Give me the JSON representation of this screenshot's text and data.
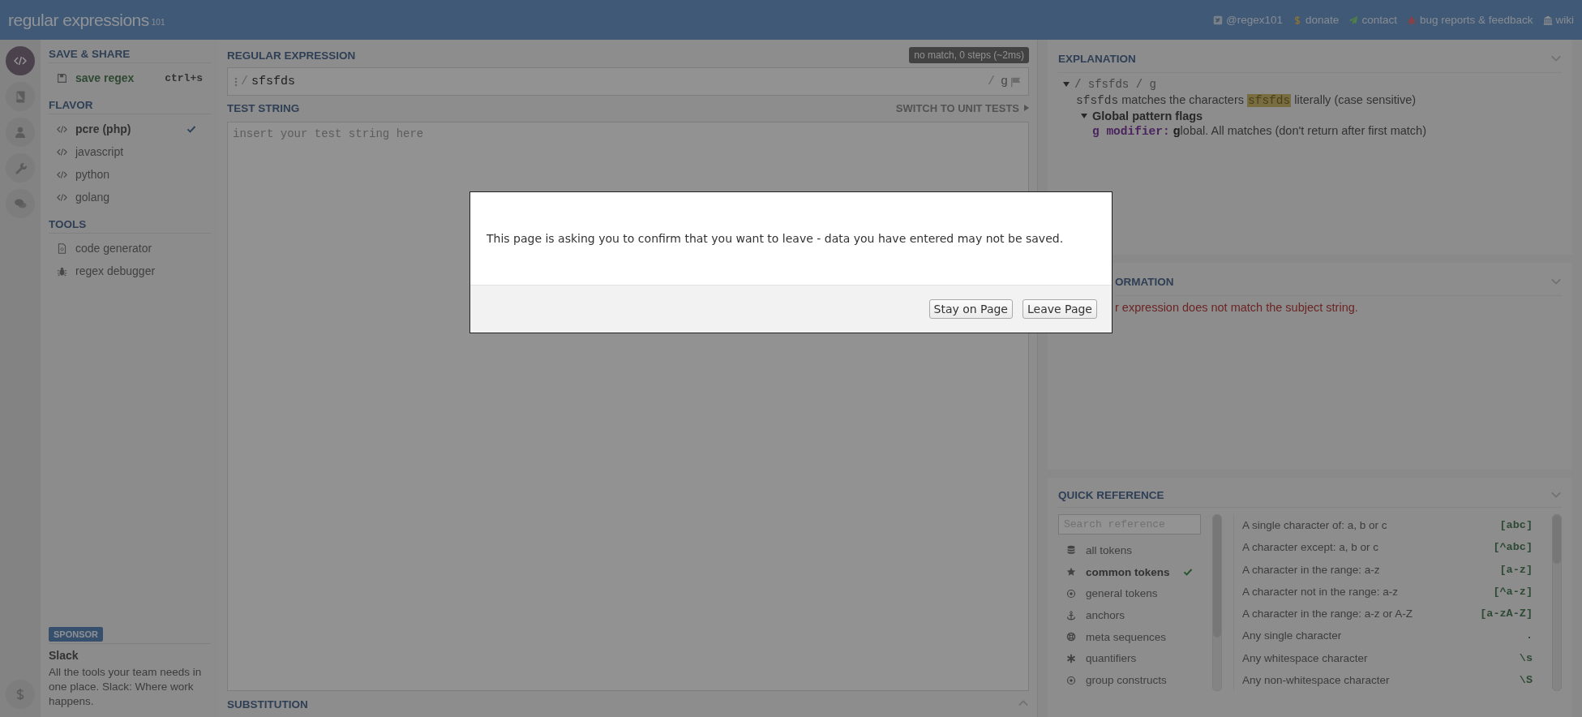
{
  "topbar": {
    "logo": "regular expressions",
    "logo_badge": "101",
    "links": [
      {
        "label": "@regex101",
        "kind": "bird"
      },
      {
        "label": "donate",
        "kind": "dollar"
      },
      {
        "label": "contact",
        "kind": "plane"
      },
      {
        "label": "bug reports & feedback",
        "kind": "bug"
      },
      {
        "label": "wiki",
        "kind": "bank"
      }
    ]
  },
  "rail": {
    "items": [
      {
        "kind": "code",
        "selected": true
      },
      {
        "kind": "book",
        "selected": false
      },
      {
        "kind": "user",
        "selected": false
      },
      {
        "kind": "wrench",
        "selected": false
      },
      {
        "kind": "chat",
        "selected": false
      }
    ],
    "bottom": {
      "kind": "dollar"
    }
  },
  "sidebar": {
    "sections": [
      {
        "title": "SAVE & SHARE",
        "items": [
          {
            "label": "save regex",
            "kind": "save",
            "shortcut": "ctrl+s",
            "selected": false
          }
        ]
      },
      {
        "title": "FLAVOR",
        "items": [
          {
            "label": "pcre (php)",
            "kind": "code",
            "selected": true
          },
          {
            "label": "javascript",
            "kind": "code",
            "selected": false
          },
          {
            "label": "python",
            "kind": "code",
            "selected": false
          },
          {
            "label": "golang",
            "kind": "code",
            "selected": false
          }
        ]
      },
      {
        "title": "TOOLS",
        "items": [
          {
            "label": "code generator",
            "kind": "file",
            "selected": false
          },
          {
            "label": "regex debugger",
            "kind": "bug",
            "selected": false
          }
        ]
      }
    ],
    "sponsor": {
      "badge": "SPONSOR",
      "name": "Slack",
      "text": "All the tools your team needs in one place. Slack: Where work happens."
    }
  },
  "regex": {
    "title": "REGULAR EXPRESSION",
    "status": "no match, 0 steps (~2ms)",
    "open": "/",
    "value": "sfsfds",
    "close": "/",
    "flags": "g"
  },
  "test_string": {
    "title": "TEST STRING",
    "switch_link": "SWITCH TO UNIT TESTS",
    "placeholder": "insert your test string here"
  },
  "substitution": {
    "title": "SUBSTITUTION"
  },
  "explanation": {
    "title": "EXPLANATION",
    "regex_line": {
      "open": "/",
      "value": "sfsfds",
      "close": "/",
      "flags": "g"
    },
    "token": {
      "code": "sfsfds",
      "before": "matches the characters",
      "literal": "sfsfds",
      "after": "literally (case sensitive)"
    },
    "flags_group": {
      "title": "Global pattern flags",
      "items": [
        {
          "flag": "g modifier:",
          "first": "g",
          "rest": "lobal. All matches (don't return after first match)"
        }
      ]
    }
  },
  "match_info": {
    "title": "ORMATION",
    "message": "r expression does not match the subject string."
  },
  "quick_reference": {
    "title": "QUICK REFERENCE",
    "search_placeholder": "Search reference",
    "categories": [
      {
        "label": "all tokens",
        "kind": "database",
        "selected": false
      },
      {
        "label": "common tokens",
        "kind": "star",
        "selected": true
      },
      {
        "label": "general tokens",
        "kind": "target",
        "selected": false
      },
      {
        "label": "anchors",
        "kind": "anchor",
        "selected": false
      },
      {
        "label": "meta sequences",
        "kind": "lifebuoy",
        "selected": false
      },
      {
        "label": "quantifiers",
        "kind": "asterisk",
        "selected": false
      },
      {
        "label": "group constructs",
        "kind": "target",
        "selected": false
      }
    ],
    "tokens": [
      {
        "description": "A single character of: a, b or c",
        "token": "[abc]"
      },
      {
        "description": "A character except: a, b or c",
        "token": "[^abc]"
      },
      {
        "description": "A character in the range: a-z",
        "token": "[a-z]"
      },
      {
        "description": "A character not in the range: a-z",
        "token": "[^a-z]"
      },
      {
        "description": "A character in the range: a-z or A-Z",
        "token": "[a-zA-Z]"
      },
      {
        "description": "Any single character",
        "token": "."
      },
      {
        "description": "Any whitespace character",
        "token": "\\s"
      },
      {
        "description": "Any non-whitespace character",
        "token": "\\S"
      }
    ]
  },
  "dialog": {
    "message": "This page is asking you to confirm that you want to leave - data you have entered may not be saved.",
    "buttons": [
      "Stay on Page",
      "Leave Page"
    ]
  }
}
